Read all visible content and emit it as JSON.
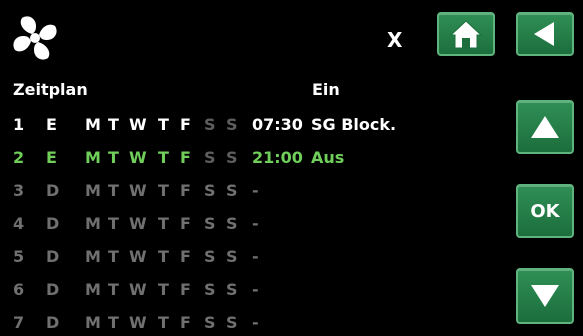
{
  "header": {
    "close_label": "X",
    "fan_icon": "fan-icon"
  },
  "table": {
    "col_schedule": "Zeitplan",
    "col_on": "Ein",
    "rows": [
      {
        "num": "1",
        "mode": "E",
        "days": [
          "M",
          "T",
          "W",
          "T",
          "F",
          "S",
          "S"
        ],
        "time": "07:30",
        "action": "SG Block.",
        "state": "active"
      },
      {
        "num": "2",
        "mode": "E",
        "days": [
          "M",
          "T",
          "W",
          "T",
          "F",
          "S",
          "S"
        ],
        "time": "21:00",
        "action": "Aus",
        "state": "selected"
      },
      {
        "num": "3",
        "mode": "D",
        "days": [
          "M",
          "T",
          "W",
          "T",
          "F",
          "S",
          "S"
        ],
        "time": "-",
        "action": "",
        "state": "disabled"
      },
      {
        "num": "4",
        "mode": "D",
        "days": [
          "M",
          "T",
          "W",
          "T",
          "F",
          "S",
          "S"
        ],
        "time": "-",
        "action": "",
        "state": "disabled"
      },
      {
        "num": "5",
        "mode": "D",
        "days": [
          "M",
          "T",
          "W",
          "T",
          "F",
          "S",
          "S"
        ],
        "time": "-",
        "action": "",
        "state": "disabled"
      },
      {
        "num": "6",
        "mode": "D",
        "days": [
          "M",
          "T",
          "W",
          "T",
          "F",
          "S",
          "S"
        ],
        "time": "-",
        "action": "",
        "state": "disabled"
      },
      {
        "num": "7",
        "mode": "D",
        "days": [
          "M",
          "T",
          "W",
          "T",
          "F",
          "S",
          "S"
        ],
        "time": "-",
        "action": "",
        "state": "disabled"
      }
    ]
  },
  "buttons": {
    "ok_label": "OK",
    "home_icon": "home-icon",
    "back_icon": "back-arrow-icon",
    "up_icon": "up-arrow-icon",
    "down_icon": "down-arrow-icon"
  },
  "colors": {
    "button_green": "#26804a",
    "selected_text": "#6fcf5a",
    "disabled_text": "#5e5e5e"
  }
}
